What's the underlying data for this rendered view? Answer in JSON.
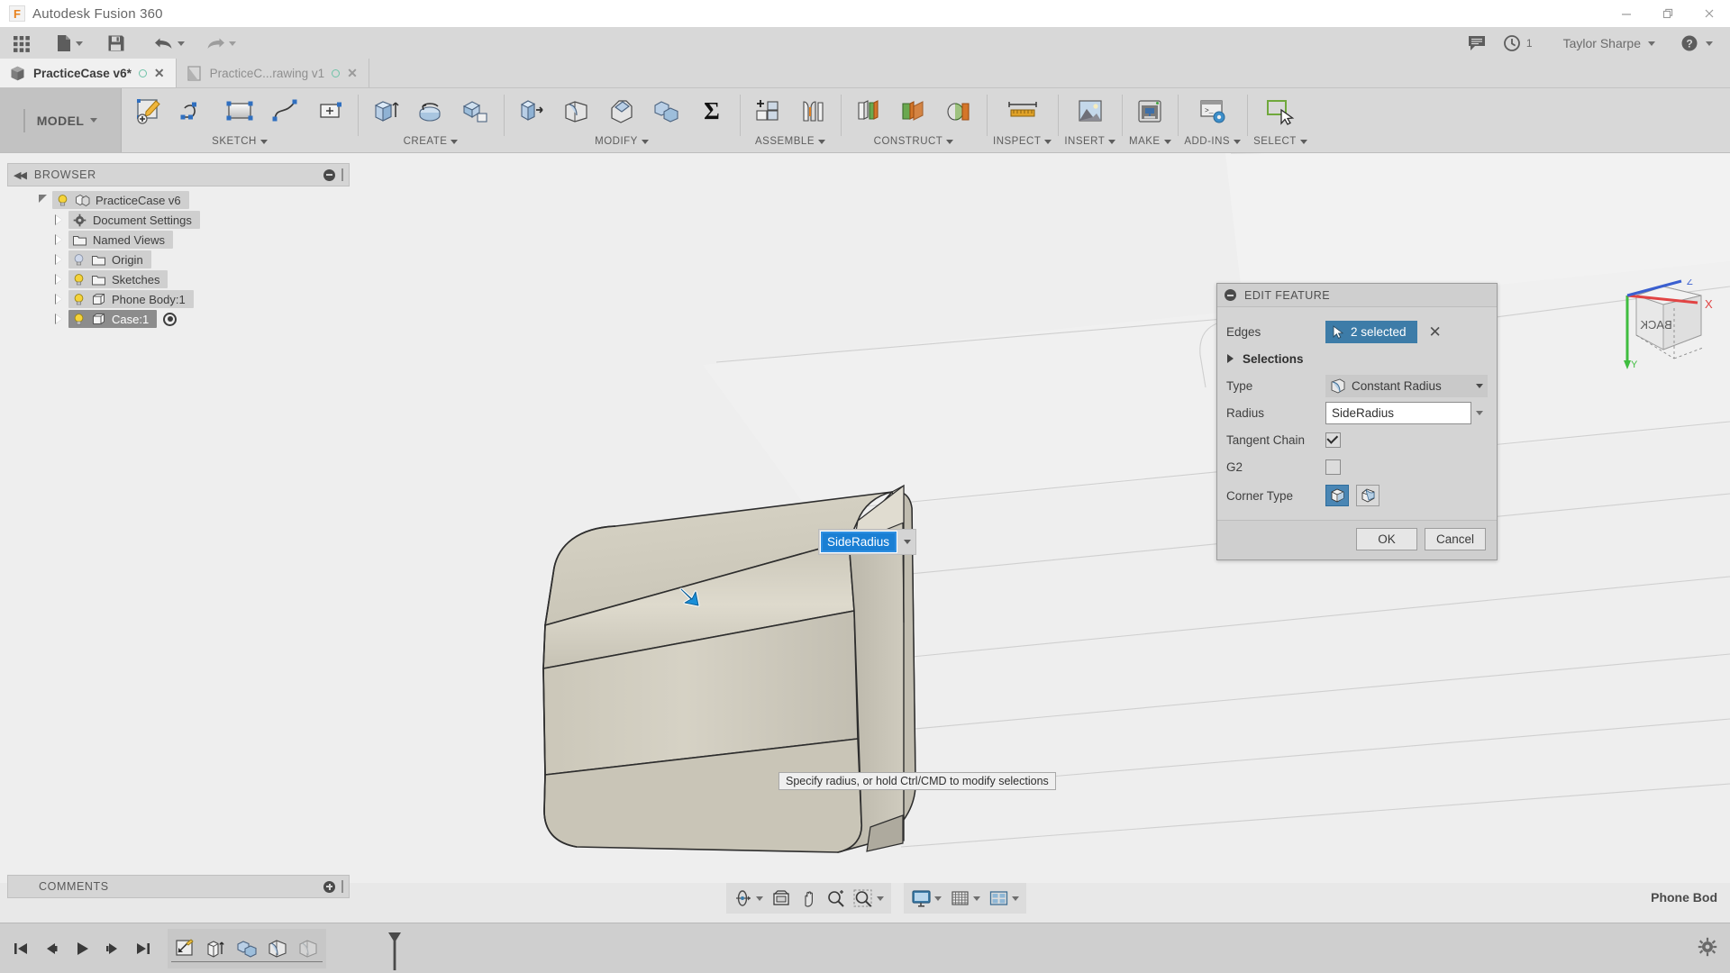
{
  "window": {
    "title": "Autodesk Fusion 360",
    "logo_letter": "F",
    "controls": {
      "minimize": "minimize-icon",
      "maximize": "restore-icon",
      "close": "close-icon"
    }
  },
  "quick_access": {
    "items": [
      {
        "name": "app-grid-button",
        "icon": "grid-icon",
        "label": ""
      },
      {
        "name": "new-file-button",
        "icon": "file-icon",
        "label": "",
        "has_caret": true
      },
      {
        "name": "save-button",
        "icon": "save-icon",
        "label": ""
      },
      {
        "name": "undo-button",
        "icon": "undo-arrow-icon",
        "label": "",
        "has_caret": true
      },
      {
        "name": "redo-button",
        "icon": "redo-arrow-icon",
        "label": "",
        "has_caret": true
      }
    ],
    "right": {
      "comment_icon": "speech-bubble-icon",
      "notifications_icon": "clock-icon",
      "notifications_count": "1",
      "user_name": "Taylor Sharpe",
      "help_icon": "question-mark-icon"
    }
  },
  "tabs": [
    {
      "label": "PracticeCase v6*",
      "active": true,
      "icon": "cube-icon",
      "status_icon": "sync-circle-icon",
      "close_icon": "close-icon"
    },
    {
      "label": "PracticeC...rawing v1",
      "active": false,
      "icon": "drawing-sheet-icon",
      "status_icon": "sync-circle-icon",
      "close_icon": "close-icon"
    }
  ],
  "ribbon": {
    "workspace": "MODEL",
    "groups": [
      {
        "label": "SKETCH",
        "buttons": [
          {
            "name": "create-sketch-button",
            "icon": "sketch-pencil-icon"
          },
          {
            "name": "line-button",
            "icon": "line-spline-icon"
          },
          {
            "name": "rectangle-button",
            "icon": "rectangle-icon"
          },
          {
            "name": "spline-button",
            "icon": "spline-icon"
          },
          {
            "name": "sketch-dimension-button",
            "icon": "sketch-dimension-icon"
          }
        ]
      },
      {
        "label": "CREATE",
        "buttons": [
          {
            "name": "extrude-button",
            "icon": "extrude-icon"
          },
          {
            "name": "revolve-button",
            "icon": "revolve-icon"
          },
          {
            "name": "loft-button",
            "icon": "loft-icon"
          }
        ]
      },
      {
        "label": "MODIFY",
        "buttons": [
          {
            "name": "press-pull-button",
            "icon": "press-pull-icon"
          },
          {
            "name": "fillet-button",
            "icon": "fillet-icon"
          },
          {
            "name": "chamfer-button",
            "icon": "chamfer-icon"
          },
          {
            "name": "combine-button",
            "icon": "combine-icon"
          },
          {
            "name": "change-parameters-button",
            "icon": "sigma-icon"
          }
        ]
      },
      {
        "label": "ASSEMBLE",
        "buttons": [
          {
            "name": "new-component-button",
            "icon": "new-component-icon"
          },
          {
            "name": "joint-button",
            "icon": "joint-icon"
          }
        ]
      },
      {
        "label": "CONSTRUCT",
        "buttons": [
          {
            "name": "offset-plane-button",
            "icon": "offset-plane-icon"
          },
          {
            "name": "plane-at-angle-button",
            "icon": "angled-plane-icon"
          },
          {
            "name": "axis-button",
            "icon": "axis-cylinder-icon"
          }
        ]
      },
      {
        "label": "INSPECT",
        "buttons": [
          {
            "name": "measure-button",
            "icon": "ruler-icon"
          }
        ]
      },
      {
        "label": "INSERT",
        "buttons": [
          {
            "name": "insert-image-button",
            "icon": "picture-icon"
          }
        ]
      },
      {
        "label": "MAKE",
        "buttons": [
          {
            "name": "3d-print-button",
            "icon": "printer-icon"
          }
        ]
      },
      {
        "label": "ADD-INS",
        "buttons": [
          {
            "name": "scripts-and-addins-button",
            "icon": "script-gear-icon"
          }
        ]
      },
      {
        "label": "SELECT",
        "buttons": [
          {
            "name": "select-button",
            "icon": "select-cursor-icon"
          }
        ]
      }
    ]
  },
  "browser": {
    "header": "BROWSER",
    "collapse_icon": "double-chevron-left-icon",
    "minimize_icon": "minus-circle-icon",
    "grip_icon": "grip-icon",
    "items": [
      {
        "label": "PracticeCase v6",
        "indent": 0,
        "expanded": true,
        "visible": true,
        "bulb": "on",
        "icon": "assembly-icon",
        "selected": false,
        "has_radio": false
      },
      {
        "label": "Document Settings",
        "indent": 1,
        "expanded": false,
        "visible": false,
        "bulb": "none",
        "icon": "gear-icon",
        "selected": false,
        "has_radio": false
      },
      {
        "label": "Named Views",
        "indent": 1,
        "expanded": false,
        "visible": false,
        "bulb": "none",
        "icon": "folder-icon",
        "selected": false,
        "has_radio": false
      },
      {
        "label": "Origin",
        "indent": 1,
        "expanded": false,
        "visible": true,
        "bulb": "off",
        "icon": "folder-icon",
        "selected": false,
        "has_radio": false
      },
      {
        "label": "Sketches",
        "indent": 1,
        "expanded": false,
        "visible": true,
        "bulb": "on",
        "icon": "folder-icon",
        "selected": false,
        "has_radio": false
      },
      {
        "label": "Phone Body:1",
        "indent": 1,
        "expanded": false,
        "visible": true,
        "bulb": "on",
        "icon": "body-icon",
        "selected": false,
        "has_radio": false
      },
      {
        "label": "Case:1",
        "indent": 1,
        "expanded": false,
        "visible": true,
        "bulb": "on",
        "icon": "body-icon",
        "selected": true,
        "has_radio": true
      }
    ]
  },
  "viewport": {
    "radius_input_value": "SideRadius",
    "radius_input_caret": "chevron-down-icon",
    "status_message": "Specify radius, or hold Ctrl/CMD to modify selections",
    "viewcube_face": "BACK",
    "viewcube_axes": {
      "x": "X",
      "y": "Y",
      "z": "Z"
    },
    "cursor_icon": "blue-arrow-cursor"
  },
  "dialog": {
    "title": "EDIT FEATURE",
    "title_icon": "minus-circle-icon",
    "rows": {
      "edges_label": "Edges",
      "edges_value": "2 selected",
      "edges_clear_icon": "close-icon",
      "selections_label": "Selections",
      "selections_expand_icon": "triangle-right-icon",
      "type_label": "Type",
      "type_value": "Constant Radius",
      "type_icon": "fillet-type-icon",
      "radius_label": "Radius",
      "radius_value": "SideRadius",
      "tangent_chain_label": "Tangent Chain",
      "tangent_chain_checked": true,
      "g2_label": "G2",
      "g2_checked": false,
      "corner_type_label": "Corner Type",
      "corner_type_options": [
        {
          "name": "corner-type-rolling-ball",
          "selected": true
        },
        {
          "name": "corner-type-setback",
          "selected": false
        }
      ]
    },
    "buttons": {
      "ok": "OK",
      "cancel": "Cancel"
    },
    "accent_color": "#3d7ca8"
  },
  "comments": {
    "header": "COMMENTS",
    "add_icon": "plus-circle-icon",
    "grip_icon": "grip-icon"
  },
  "body_tag": "Phone Bod",
  "navbar": {
    "group1": [
      {
        "name": "orbit-button",
        "icon": "orbit-icon",
        "caret": true
      },
      {
        "name": "look-at-button",
        "icon": "look-at-icon",
        "caret": false
      },
      {
        "name": "pan-button",
        "icon": "hand-pan-icon",
        "caret": false
      },
      {
        "name": "zoom-button",
        "icon": "zoom-magnifier-icon",
        "caret": false
      },
      {
        "name": "fit-button",
        "icon": "fit-magnifier-icon",
        "caret": true
      }
    ],
    "group2": [
      {
        "name": "display-settings-button",
        "icon": "monitor-icon",
        "caret": true
      },
      {
        "name": "grid-snap-button",
        "icon": "grid-snap-icon",
        "caret": true
      },
      {
        "name": "viewports-button",
        "icon": "viewports-icon",
        "caret": true
      }
    ]
  },
  "timeline": {
    "nav": [
      {
        "name": "go-to-beginning-button",
        "icon": "skip-start-icon"
      },
      {
        "name": "step-back-button",
        "icon": "step-back-icon"
      },
      {
        "name": "play-button",
        "icon": "play-icon"
      },
      {
        "name": "step-forward-button",
        "icon": "step-forward-icon"
      },
      {
        "name": "go-to-end-button",
        "icon": "skip-end-icon"
      }
    ],
    "features": [
      {
        "name": "timeline-sketch-feature",
        "icon": "sketch-pencil-icon",
        "dimmed": false
      },
      {
        "name": "timeline-extrude-feature",
        "icon": "extrude-icon",
        "dimmed": false
      },
      {
        "name": "timeline-combine-feature",
        "icon": "combine-icon",
        "dimmed": false
      },
      {
        "name": "timeline-fillet-feature",
        "icon": "fillet-icon",
        "dimmed": false
      },
      {
        "name": "timeline-fillet-feature-2",
        "icon": "fillet-icon",
        "dimmed": true
      }
    ],
    "marker_icon": "timeline-marker-icon",
    "settings_icon": "gear-icon"
  }
}
